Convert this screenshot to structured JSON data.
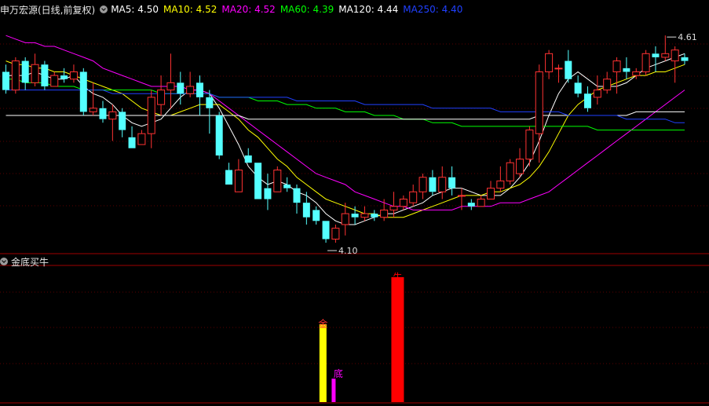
{
  "main": {
    "title": "申万宏源(日线,前复权)",
    "ma_labels": [
      {
        "text": "MA5: 4.50",
        "color": "#ffffff"
      },
      {
        "text": "MA10: 4.52",
        "color": "#ffff00"
      },
      {
        "text": "MA20: 4.52",
        "color": "#ff00ff"
      },
      {
        "text": "MA60: 4.39",
        "color": "#00ff00"
      },
      {
        "text": "MA120: 4.44",
        "color": "#ffffff"
      },
      {
        "text": "MA250: 4.40",
        "color": "#2040ff"
      }
    ],
    "high_label": "4.61",
    "low_label": "4.10"
  },
  "sub": {
    "title": "金底买牛",
    "labels": [
      "金",
      "底",
      "牛"
    ]
  },
  "chart_data": {
    "type": "candlestick",
    "candles": [
      [
        4.55,
        4.5,
        4.57,
        4.49
      ],
      [
        4.5,
        4.58,
        4.59,
        4.49
      ],
      [
        4.58,
        4.52,
        4.59,
        4.5
      ],
      [
        4.52,
        4.57,
        4.6,
        4.51
      ],
      [
        4.57,
        4.51,
        4.58,
        4.5
      ],
      [
        4.51,
        4.54,
        4.55,
        4.51
      ],
      [
        4.54,
        4.53,
        4.56,
        4.52
      ],
      [
        4.53,
        4.55,
        4.57,
        4.52
      ],
      [
        4.55,
        4.44,
        4.56,
        4.43
      ],
      [
        4.44,
        4.45,
        4.52,
        4.43
      ],
      [
        4.45,
        4.42,
        4.47,
        4.41
      ],
      [
        4.42,
        4.44,
        4.46,
        4.36
      ],
      [
        4.44,
        4.39,
        4.45,
        4.37
      ],
      [
        4.37,
        4.34,
        4.4,
        4.34
      ],
      [
        4.35,
        4.38,
        4.39,
        4.35
      ],
      [
        4.38,
        4.48,
        4.5,
        4.34
      ],
      [
        4.46,
        4.5,
        4.54,
        4.43
      ],
      [
        4.5,
        4.52,
        4.6,
        4.45
      ],
      [
        4.52,
        4.49,
        4.55,
        4.46
      ],
      [
        4.49,
        4.51,
        4.55,
        4.48
      ],
      [
        4.52,
        4.48,
        4.54,
        4.43
      ],
      [
        4.48,
        4.45,
        4.5,
        4.38
      ],
      [
        4.43,
        4.32,
        4.44,
        4.31
      ],
      [
        4.28,
        4.24,
        4.3,
        4.24
      ],
      [
        4.22,
        4.28,
        4.31,
        4.22
      ],
      [
        4.32,
        4.3,
        4.34,
        4.3
      ],
      [
        4.3,
        4.2,
        4.3,
        4.2
      ],
      [
        4.23,
        4.2,
        4.27,
        4.17
      ],
      [
        4.22,
        4.28,
        4.29,
        4.22
      ],
      [
        4.24,
        4.23,
        4.26,
        4.22
      ],
      [
        4.23,
        4.19,
        4.24,
        4.16
      ],
      [
        4.19,
        4.15,
        4.22,
        4.13
      ],
      [
        4.17,
        4.14,
        4.18,
        4.13
      ],
      [
        4.14,
        4.09,
        4.14,
        4.08
      ],
      [
        4.09,
        4.12,
        4.13,
        4.08
      ],
      [
        4.13,
        4.16,
        4.19,
        4.1
      ],
      [
        4.16,
        4.15,
        4.18,
        4.13
      ],
      [
        4.15,
        4.16,
        4.18,
        4.14
      ],
      [
        4.16,
        4.15,
        4.17,
        4.14
      ],
      [
        4.15,
        4.17,
        4.2,
        4.14
      ],
      [
        4.17,
        4.18,
        4.22,
        4.15
      ],
      [
        4.18,
        4.2,
        4.21,
        4.17
      ],
      [
        4.19,
        4.22,
        4.24,
        4.18
      ],
      [
        4.22,
        4.26,
        4.27,
        4.2
      ],
      [
        4.26,
        4.22,
        4.28,
        4.21
      ],
      [
        4.22,
        4.26,
        4.29,
        4.2
      ],
      [
        4.26,
        4.23,
        4.29,
        4.21
      ],
      [
        4.21,
        4.21,
        4.23,
        4.17
      ],
      [
        4.19,
        4.18,
        4.2,
        4.17
      ],
      [
        4.18,
        4.2,
        4.21,
        4.18
      ],
      [
        4.2,
        4.23,
        4.25,
        4.2
      ],
      [
        4.23,
        4.25,
        4.29,
        4.22
      ],
      [
        4.25,
        4.3,
        4.31,
        4.24
      ],
      [
        4.27,
        4.31,
        4.34,
        4.26
      ],
      [
        4.31,
        4.39,
        4.4,
        4.29
      ],
      [
        4.38,
        4.55,
        4.57,
        4.3
      ],
      [
        4.55,
        4.6,
        4.61,
        4.53
      ],
      [
        4.56,
        4.56,
        4.57,
        4.52
      ],
      [
        4.58,
        4.53,
        4.61,
        4.52
      ],
      [
        4.52,
        4.49,
        4.54,
        4.48
      ],
      [
        4.49,
        4.45,
        4.51,
        4.44
      ],
      [
        4.48,
        4.5,
        4.54,
        4.46
      ],
      [
        4.5,
        4.53,
        4.55,
        4.49
      ],
      [
        4.55,
        4.58,
        4.59,
        4.49
      ],
      [
        4.56,
        4.55,
        4.59,
        4.53
      ],
      [
        4.54,
        4.55,
        4.56,
        4.53
      ],
      [
        4.55,
        4.6,
        4.61,
        4.54
      ],
      [
        4.6,
        4.59,
        4.62,
        4.55
      ],
      [
        4.59,
        4.6,
        4.65,
        4.58
      ],
      [
        4.58,
        4.61,
        4.62,
        4.52
      ],
      [
        4.59,
        4.58,
        4.6,
        4.57
      ]
    ],
    "ma": {
      "MA5": {
        "color": "#ffffff",
        "values": [
          4.54,
          4.54,
          4.54,
          4.55,
          4.54,
          4.53,
          4.53,
          4.54,
          4.51,
          4.49,
          4.48,
          4.46,
          4.43,
          4.41,
          4.4,
          4.41,
          4.42,
          4.45,
          4.48,
          4.5,
          4.5,
          4.49,
          4.45,
          4.4,
          4.35,
          4.29,
          4.26,
          4.24,
          4.25,
          4.24,
          4.22,
          4.21,
          4.19,
          4.16,
          4.14,
          4.13,
          4.13,
          4.14,
          4.15,
          4.16,
          4.16,
          4.17,
          4.18,
          4.19,
          4.21,
          4.22,
          4.23,
          4.23,
          4.22,
          4.21,
          4.21,
          4.21,
          4.23,
          4.26,
          4.3,
          4.36,
          4.43,
          4.49,
          4.53,
          4.55,
          4.53,
          4.51,
          4.51,
          4.51,
          4.52,
          4.54,
          4.56,
          4.57,
          4.58,
          4.59,
          4.6
        ]
      },
      "MA10": {
        "color": "#ffff00",
        "values": [
          4.58,
          4.57,
          4.57,
          4.56,
          4.56,
          4.55,
          4.55,
          4.54,
          4.53,
          4.52,
          4.51,
          4.5,
          4.49,
          4.47,
          4.45,
          4.44,
          4.43,
          4.43,
          4.44,
          4.45,
          4.46,
          4.46,
          4.46,
          4.44,
          4.42,
          4.39,
          4.37,
          4.34,
          4.31,
          4.29,
          4.26,
          4.24,
          4.22,
          4.2,
          4.19,
          4.18,
          4.17,
          4.16,
          4.16,
          4.15,
          4.15,
          4.15,
          4.16,
          4.17,
          4.18,
          4.19,
          4.2,
          4.21,
          4.21,
          4.21,
          4.22,
          4.22,
          4.23,
          4.24,
          4.26,
          4.29,
          4.33,
          4.38,
          4.43,
          4.46,
          4.48,
          4.5,
          4.51,
          4.52,
          4.53,
          4.54,
          4.54,
          4.55,
          4.55,
          4.56,
          4.57
        ]
      },
      "MA20": {
        "color": "#ff00ff",
        "values": [
          4.65,
          4.64,
          4.63,
          4.63,
          4.62,
          4.62,
          4.61,
          4.6,
          4.59,
          4.58,
          4.56,
          4.55,
          4.54,
          4.53,
          4.52,
          4.51,
          4.51,
          4.51,
          4.51,
          4.5,
          4.5,
          4.49,
          4.47,
          4.45,
          4.43,
          4.41,
          4.39,
          4.37,
          4.35,
          4.33,
          4.31,
          4.29,
          4.27,
          4.26,
          4.25,
          4.24,
          4.22,
          4.21,
          4.2,
          4.19,
          4.18,
          4.18,
          4.17,
          4.17,
          4.17,
          4.17,
          4.17,
          4.18,
          4.18,
          4.18,
          4.18,
          4.19,
          4.19,
          4.19,
          4.2,
          4.21,
          4.22,
          4.24,
          4.26,
          4.28,
          4.3,
          4.32,
          4.34,
          4.36,
          4.38,
          4.4,
          4.42,
          4.44,
          4.46,
          4.48,
          4.5
        ]
      },
      "MA60": {
        "color": "#00ff00",
        "values": [
          4.53,
          4.53,
          4.52,
          4.52,
          4.52,
          4.51,
          4.51,
          4.51,
          4.5,
          4.5,
          4.5,
          4.5,
          4.5,
          4.5,
          4.5,
          4.5,
          4.49,
          4.49,
          4.49,
          4.49,
          4.49,
          4.49,
          4.48,
          4.48,
          4.48,
          4.48,
          4.47,
          4.47,
          4.47,
          4.46,
          4.46,
          4.46,
          4.45,
          4.45,
          4.45,
          4.44,
          4.44,
          4.44,
          4.43,
          4.43,
          4.43,
          4.42,
          4.42,
          4.42,
          4.41,
          4.41,
          4.41,
          4.4,
          4.4,
          4.4,
          4.4,
          4.4,
          4.4,
          4.4,
          4.4,
          4.4,
          4.4,
          4.4,
          4.4,
          4.4,
          4.4,
          4.39,
          4.39,
          4.39,
          4.39,
          4.39,
          4.39,
          4.39,
          4.39,
          4.39,
          4.39
        ]
      },
      "MA120": {
        "color": "#ffffff",
        "values": [
          4.43,
          4.43,
          4.43,
          4.43,
          4.43,
          4.43,
          4.43,
          4.43,
          4.43,
          4.43,
          4.43,
          4.43,
          4.43,
          4.43,
          4.43,
          4.43,
          4.43,
          4.43,
          4.43,
          4.43,
          4.43,
          4.43,
          4.43,
          4.43,
          4.43,
          4.42,
          4.42,
          4.42,
          4.42,
          4.42,
          4.42,
          4.42,
          4.42,
          4.42,
          4.42,
          4.42,
          4.42,
          4.42,
          4.42,
          4.42,
          4.42,
          4.42,
          4.42,
          4.42,
          4.42,
          4.42,
          4.42,
          4.42,
          4.42,
          4.42,
          4.42,
          4.42,
          4.42,
          4.42,
          4.42,
          4.43,
          4.43,
          4.43,
          4.43,
          4.43,
          4.43,
          4.43,
          4.43,
          4.43,
          4.43,
          4.44,
          4.44,
          4.44,
          4.44,
          4.44,
          4.44
        ]
      },
      "MA250": {
        "color": "#2040ff",
        "values": [
          4.5,
          4.5,
          4.5,
          4.5,
          4.5,
          4.5,
          4.5,
          4.5,
          4.5,
          4.5,
          4.5,
          4.49,
          4.49,
          4.49,
          4.49,
          4.49,
          4.49,
          4.49,
          4.49,
          4.49,
          4.49,
          4.49,
          4.48,
          4.48,
          4.48,
          4.48,
          4.48,
          4.48,
          4.48,
          4.48,
          4.47,
          4.47,
          4.47,
          4.47,
          4.47,
          4.47,
          4.47,
          4.46,
          4.46,
          4.46,
          4.46,
          4.46,
          4.46,
          4.46,
          4.45,
          4.45,
          4.45,
          4.45,
          4.45,
          4.45,
          4.45,
          4.44,
          4.44,
          4.44,
          4.44,
          4.44,
          4.44,
          4.44,
          4.43,
          4.43,
          4.43,
          4.43,
          4.43,
          4.43,
          4.42,
          4.42,
          4.42,
          4.42,
          4.42,
          4.41,
          4.41
        ]
      }
    },
    "signals": [
      {
        "index": 32.7,
        "value": 1.0,
        "color": "#ffff00"
      },
      {
        "index": 33.8,
        "value": 0.3,
        "color": "#ff00ff"
      },
      {
        "index": 40.4,
        "value": 1.6,
        "color": "#ff0000"
      }
    ],
    "price_range": [
      4.05,
      4.7
    ],
    "signal_range": [
      0,
      1.75
    ]
  }
}
